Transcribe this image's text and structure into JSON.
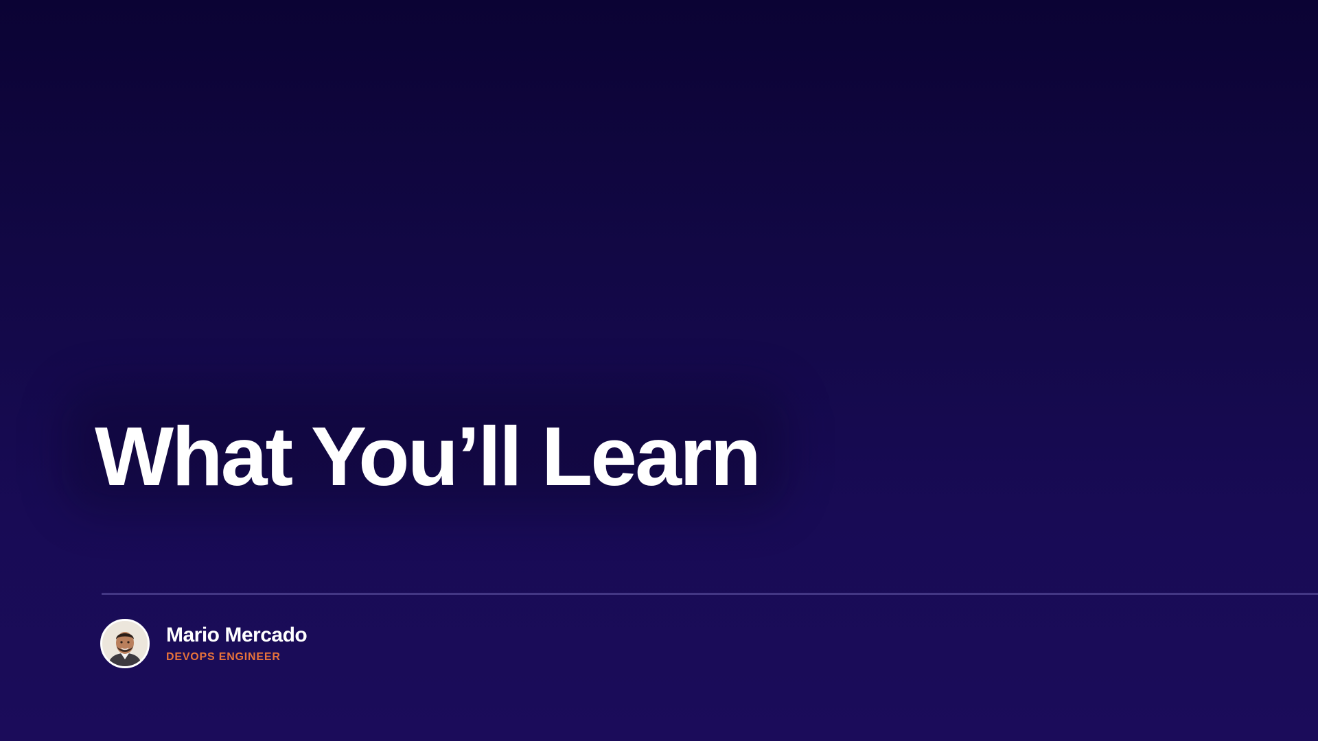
{
  "slide": {
    "title": "What You’ll Learn",
    "presenter": {
      "name": "Mario Mercado",
      "role": "DEVOPS ENGINEER",
      "avatar_icon": "presenter-photo"
    }
  },
  "colors": {
    "background_top": "#0b0334",
    "background_bottom": "#1b0c5a",
    "title_text": "#ffffff",
    "role_accent": "#e8733a",
    "divider": "#4b3f8c"
  }
}
